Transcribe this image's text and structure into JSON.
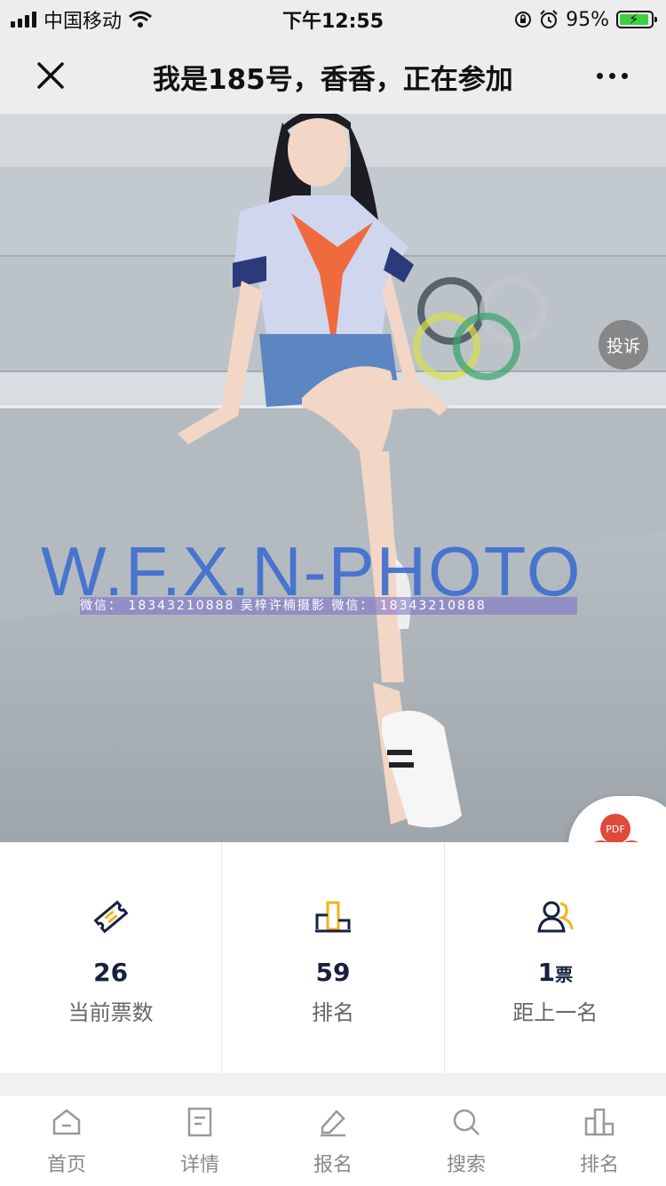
{
  "status_bar": {
    "carrier": "中国移动",
    "time": "下午12:55",
    "battery_percent": "95%",
    "battery_level": 0.95
  },
  "nav": {
    "title": "我是185号，香香，正在参加"
  },
  "photo": {
    "complain_label": "投诉",
    "watermark": "W.F.X.N-PHOTO",
    "watermark_sub": "微信： 18343210888 吴梓许楠摄影 微信： 18343210888"
  },
  "pdf_fab": {
    "label": "PDF"
  },
  "stats": [
    {
      "value": "26",
      "unit": "",
      "label": "当前票数",
      "icon": "ticket-icon"
    },
    {
      "value": "59",
      "unit": "",
      "label": "排名",
      "icon": "podium-icon"
    },
    {
      "value": "1",
      "unit": "票",
      "label": "距上一名",
      "icon": "users-icon"
    }
  ],
  "tabs": [
    {
      "label": "首页",
      "icon": "home-icon"
    },
    {
      "label": "详情",
      "icon": "document-icon"
    },
    {
      "label": "报名",
      "icon": "edit-icon"
    },
    {
      "label": "搜索",
      "icon": "search-icon"
    },
    {
      "label": "排名",
      "icon": "ranking-icon"
    }
  ],
  "colors": {
    "accent_gold": "#f3b21a",
    "navy": "#162040",
    "pdf_red": "#e04a3c"
  }
}
